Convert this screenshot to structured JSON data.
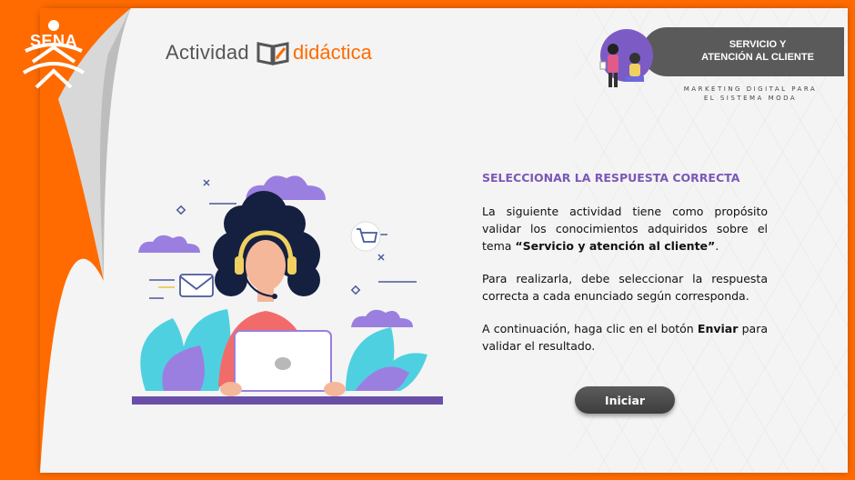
{
  "logo": {
    "text": "SENA"
  },
  "brand": {
    "word1": "Actividad",
    "word2": "didáctica"
  },
  "badge": {
    "title_line1": "SERVICIO Y",
    "title_line2": "ATENCIÓN AL CLIENTE",
    "subtitle_line1": "MARKETING DIGITAL PARA",
    "subtitle_line2": "EL SISTEMA MODA"
  },
  "content": {
    "heading": "SELECCIONAR LA RESPUESTA CORRECTA",
    "p1_text": "La siguiente actividad tiene como propósito validar los conocimientos adquiridos sobre el tema ",
    "p1_bold": "“Servicio y atención al cliente”",
    "p1_end": ".",
    "p2": "Para realizarla, debe seleccionar la respuesta correcta a cada enunciado según corresponda.",
    "p3_text": "A continuación, haga clic en el botón ",
    "p3_bold": "Enviar",
    "p3_end": " para validar el resultado."
  },
  "start_button": {
    "label": "Iniciar"
  },
  "colors": {
    "orange": "#ff6b00",
    "purple": "#7a58b8",
    "gray_button": "#4a4a4a",
    "illustration_purple": "#9b7fe0",
    "illustration_teal": "#4fd0e0"
  }
}
